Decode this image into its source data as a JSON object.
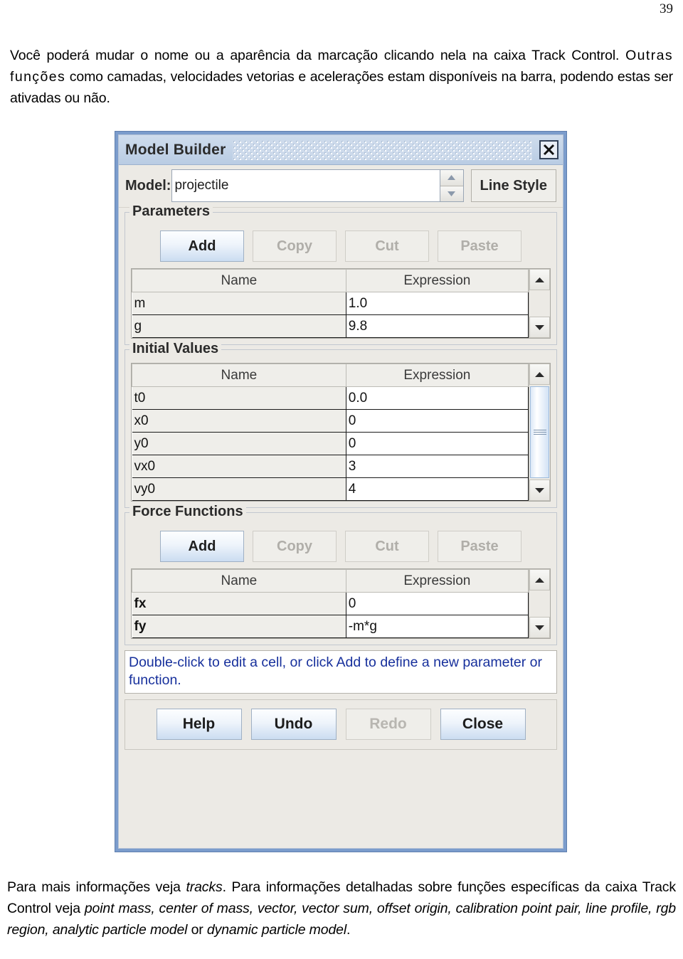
{
  "page": {
    "number": "39"
  },
  "top_paragraph": {
    "line1": "Você poderá mudar o nome ou a aparência da marcação clicando nela na caixa Track",
    "line2a": "Control.",
    "line2b": "Outras funções",
    "line2c": "como camadas, velocidades vetorias e acelerações estam",
    "line3": "disponíveis na barra, podendo estas ser ativadas ou não."
  },
  "dialog": {
    "title": "Model Builder",
    "close_icon": "close-x-icon",
    "model_label": "Model:",
    "model_value": "projectile",
    "spinner_up_icon": "triangle-up-icon",
    "spinner_down_icon": "triangle-down-icon",
    "line_style_label": "Line Style",
    "parameters": {
      "title": "Parameters",
      "buttons": [
        {
          "label": "Add",
          "enabled": true
        },
        {
          "label": "Copy",
          "enabled": false
        },
        {
          "label": "Cut",
          "enabled": false
        },
        {
          "label": "Paste",
          "enabled": false
        }
      ],
      "columns": [
        "Name",
        "Expression"
      ],
      "rows": [
        {
          "name": "m",
          "expression": "1.0"
        },
        {
          "name": "g",
          "expression": "9.8"
        }
      ]
    },
    "initial_values": {
      "title": "Initial Values",
      "columns": [
        "Name",
        "Expression"
      ],
      "rows": [
        {
          "name": "t0",
          "expression": "0.0"
        },
        {
          "name": "x0",
          "expression": "0"
        },
        {
          "name": "y0",
          "expression": "0"
        },
        {
          "name": "vx0",
          "expression": "3"
        },
        {
          "name": "vy0",
          "expression": "4"
        }
      ]
    },
    "force_functions": {
      "title": "Force Functions",
      "buttons": [
        {
          "label": "Add",
          "enabled": true
        },
        {
          "label": "Copy",
          "enabled": false
        },
        {
          "label": "Cut",
          "enabled": false
        },
        {
          "label": "Paste",
          "enabled": false
        }
      ],
      "columns": [
        "Name",
        "Expression"
      ],
      "rows": [
        {
          "name": "fx",
          "expression": "0"
        },
        {
          "name": "fy",
          "expression": "-m*g"
        }
      ]
    },
    "hint": "Double-click to edit a cell, or click Add to define a new parameter or function.",
    "footer_buttons": [
      {
        "label": "Help",
        "enabled": true
      },
      {
        "label": "Undo",
        "enabled": true
      },
      {
        "label": "Redo",
        "enabled": false
      },
      {
        "label": "Close",
        "enabled": true
      }
    ]
  },
  "bottom_paragraph": {
    "t1": "Para mais informações veja ",
    "i1": "tracks",
    "t2": ". Para informações detalhadas sobre funções específicas da caixa Track Control veja ",
    "i2": "point mass, center of mass, vector, vector sum, offset origin, calibration point pair, line profile, rgb region, analytic particle model",
    "t3": " or ",
    "i3": "dynamic particle model",
    "t4": "."
  },
  "colors": {
    "dialog_frame": "#7b9ccc",
    "titlebar": "#c5d5e9",
    "hint_text": "#17309c",
    "button_accent": "#cbddf1"
  }
}
